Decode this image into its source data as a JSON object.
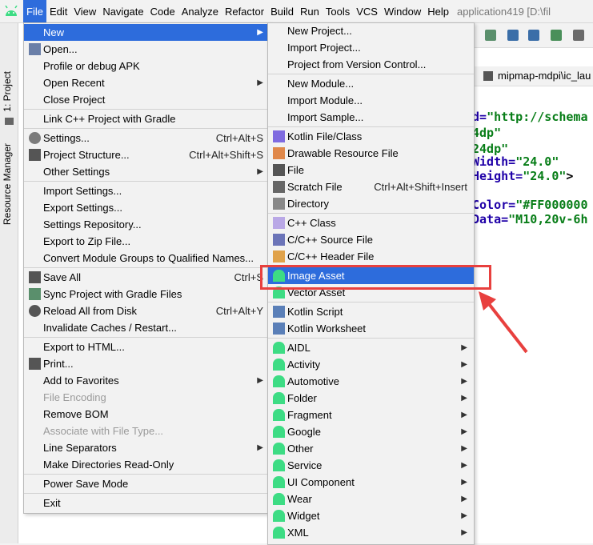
{
  "menubar": {
    "items": [
      "File",
      "Edit",
      "View",
      "Navigate",
      "Code",
      "Analyze",
      "Refactor",
      "Build",
      "Run",
      "Tools",
      "VCS",
      "Window",
      "Help"
    ],
    "window_title": "application419 [D:\\fil"
  },
  "side_tabs": {
    "project": "1: Project",
    "resource_manager": "Resource Manager"
  },
  "file_menu": {
    "items": [
      {
        "label": "New",
        "shortcut": "",
        "submenu": true
      },
      {
        "label": "Open...",
        "shortcut": ""
      },
      {
        "label": "Profile or debug APK",
        "shortcut": ""
      },
      {
        "label": "Open Recent",
        "shortcut": "",
        "submenu": true
      },
      {
        "label": "Close Project",
        "shortcut": ""
      },
      {
        "label": "Link C++ Project with Gradle",
        "shortcut": ""
      },
      {
        "label": "Settings...",
        "shortcut": "Ctrl+Alt+S"
      },
      {
        "label": "Project Structure...",
        "shortcut": "Ctrl+Alt+Shift+S"
      },
      {
        "label": "Other Settings",
        "shortcut": "",
        "submenu": true
      },
      {
        "label": "Import Settings...",
        "shortcut": ""
      },
      {
        "label": "Export Settings...",
        "shortcut": ""
      },
      {
        "label": "Settings Repository...",
        "shortcut": ""
      },
      {
        "label": "Export to Zip File...",
        "shortcut": ""
      },
      {
        "label": "Convert Module Groups to Qualified Names...",
        "shortcut": ""
      },
      {
        "label": "Save All",
        "shortcut": "Ctrl+S"
      },
      {
        "label": "Sync Project with Gradle Files",
        "shortcut": ""
      },
      {
        "label": "Reload All from Disk",
        "shortcut": "Ctrl+Alt+Y"
      },
      {
        "label": "Invalidate Caches / Restart...",
        "shortcut": ""
      },
      {
        "label": "Export to HTML...",
        "shortcut": ""
      },
      {
        "label": "Print...",
        "shortcut": ""
      },
      {
        "label": "Add to Favorites",
        "shortcut": "",
        "submenu": true
      },
      {
        "label": "File Encoding",
        "shortcut": ""
      },
      {
        "label": "Remove BOM",
        "shortcut": ""
      },
      {
        "label": "Associate with File Type...",
        "shortcut": ""
      },
      {
        "label": "Line Separators",
        "shortcut": "",
        "submenu": true
      },
      {
        "label": "Make Directories Read-Only",
        "shortcut": ""
      },
      {
        "label": "Power Save Mode",
        "shortcut": ""
      },
      {
        "label": "Exit",
        "shortcut": ""
      }
    ]
  },
  "new_submenu": {
    "items": [
      {
        "label": "New Project..."
      },
      {
        "label": "Import Project..."
      },
      {
        "label": "Project from Version Control..."
      },
      {
        "label": "New Module..."
      },
      {
        "label": "Import Module..."
      },
      {
        "label": "Import Sample..."
      },
      {
        "label": "Kotlin File/Class"
      },
      {
        "label": "Drawable Resource File"
      },
      {
        "label": "File"
      },
      {
        "label": "Scratch File",
        "shortcut": "Ctrl+Alt+Shift+Insert"
      },
      {
        "label": "Directory"
      },
      {
        "label": "C++ Class"
      },
      {
        "label": "C/C++ Source File"
      },
      {
        "label": "C/C++ Header File"
      },
      {
        "label": "Image Asset"
      },
      {
        "label": "Vector Asset"
      },
      {
        "label": "Kotlin Script"
      },
      {
        "label": "Kotlin Worksheet"
      },
      {
        "label": "AIDL"
      },
      {
        "label": "Activity"
      },
      {
        "label": "Automotive"
      },
      {
        "label": "Folder"
      },
      {
        "label": "Fragment"
      },
      {
        "label": "Google"
      },
      {
        "label": "Other"
      },
      {
        "label": "Service"
      },
      {
        "label": "UI Component"
      },
      {
        "label": "Wear"
      },
      {
        "label": "Widget"
      },
      {
        "label": "XML"
      }
    ]
  },
  "editor": {
    "tab_label": "mipmap-mdpi\\ic_lau",
    "code": [
      {
        "attr": "d=",
        "val": "\"http://schema",
        "rest": ""
      },
      {
        "attr": "",
        "val": "4dp\"",
        "rest": ""
      },
      {
        "attr": "",
        "val": "24dp\"",
        "rest": ""
      },
      {
        "attr": "Width=",
        "val": "\"24.0\"",
        "rest": ""
      },
      {
        "attr": "Height=",
        "val": "\"24.0\"",
        "rest": ">"
      },
      {
        "attr": "Color=",
        "val": "\"#FF000000",
        "rest": ""
      },
      {
        "attr": "Data=",
        "val": "\"M10,20v-6h",
        "rest": ""
      }
    ]
  },
  "colors": {
    "highlight": "#2d6cdc",
    "annotation_red": "#e8403e",
    "android_green": "#3ddc84"
  }
}
